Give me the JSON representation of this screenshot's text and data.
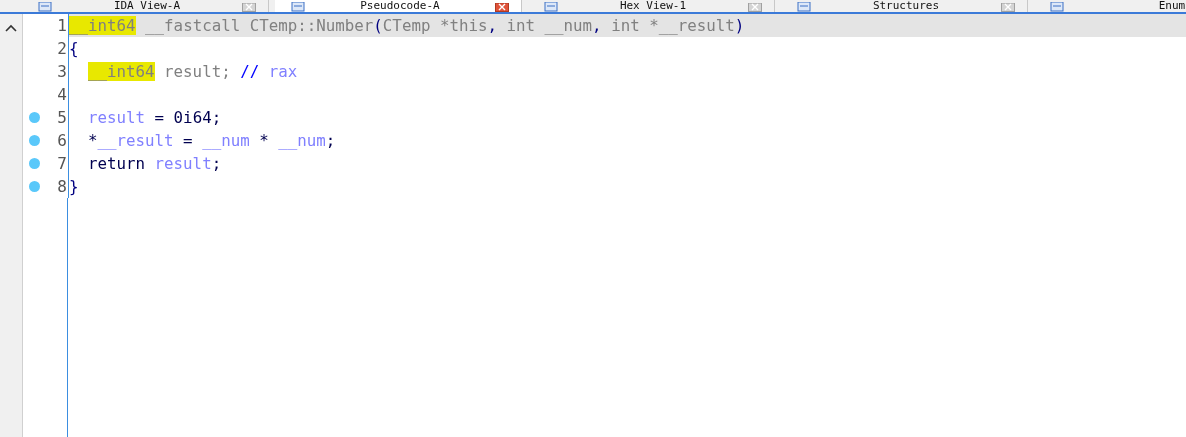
{
  "tabs": [
    {
      "label": "IDA View-A",
      "selected": false
    },
    {
      "label": "Pseudocode-A",
      "selected": true
    },
    {
      "label": "Hex View-1",
      "selected": false
    },
    {
      "label": "Structures",
      "selected": false
    },
    {
      "label": "Enum",
      "selected": false
    }
  ],
  "code": [
    {
      "number": "1",
      "current": true,
      "breakpoint": false,
      "indent": false,
      "tokens": [
        {
          "kind": "hl",
          "text": "__int64"
        },
        {
          "kind": "decl",
          "text": " __fastcall CTemp::Number"
        },
        {
          "kind": "punct",
          "text": "("
        },
        {
          "kind": "decl",
          "text": "CTemp *this"
        },
        {
          "kind": "punct",
          "text": ","
        },
        {
          "kind": "decl",
          "text": " int __num"
        },
        {
          "kind": "punct",
          "text": ","
        },
        {
          "kind": "decl",
          "text": " int *__result"
        },
        {
          "kind": "punct",
          "text": ")"
        }
      ]
    },
    {
      "number": "2",
      "current": false,
      "breakpoint": false,
      "indent": false,
      "tokens": [
        {
          "kind": "punct",
          "text": "{"
        }
      ]
    },
    {
      "number": "3",
      "current": false,
      "breakpoint": false,
      "indent": true,
      "tokens": [
        {
          "kind": "hl",
          "text": "__int64"
        },
        {
          "kind": "decl",
          "text": " result;"
        },
        {
          "kind": "comment",
          "text": " // "
        },
        {
          "kind": "var",
          "text": "rax"
        }
      ]
    },
    {
      "number": "4",
      "current": false,
      "breakpoint": false
    },
    {
      "number": "5",
      "current": false,
      "breakpoint": true,
      "indent": true,
      "tokens": [
        {
          "kind": "var",
          "text": "result"
        },
        {
          "kind": "kw",
          "text": " = 0i64;"
        }
      ]
    },
    {
      "number": "6",
      "current": false,
      "breakpoint": true,
      "indent": true,
      "tokens": [
        {
          "kind": "kw",
          "text": "*"
        },
        {
          "kind": "var",
          "text": "__result"
        },
        {
          "kind": "kw",
          "text": " = "
        },
        {
          "kind": "var",
          "text": "__num"
        },
        {
          "kind": "kw",
          "text": " * "
        },
        {
          "kind": "var",
          "text": "__num"
        },
        {
          "kind": "kw",
          "text": ";"
        }
      ]
    },
    {
      "number": "7",
      "current": false,
      "breakpoint": true,
      "indent": true,
      "tokens": [
        {
          "kind": "kw",
          "text": "return "
        },
        {
          "kind": "var",
          "text": "result"
        },
        {
          "kind": "kw",
          "text": ";"
        }
      ]
    },
    {
      "number": "8",
      "current": false,
      "breakpoint": true,
      "indent": false,
      "tokens": [
        {
          "kind": "punct",
          "text": "}"
        }
      ]
    }
  ]
}
